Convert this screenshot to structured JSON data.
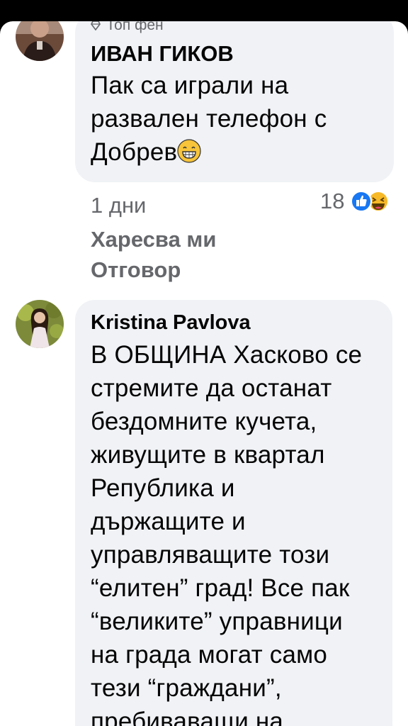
{
  "comments": [
    {
      "badge": "Топ фен",
      "author": "ИВАН ГИКОВ",
      "lines": [
        "Пак са играли на",
        "развален телефон с",
        "Добрев"
      ],
      "time": "1 дни",
      "like_label": "Харесва ми",
      "reply_label": "Отговор",
      "reaction_count": "18",
      "reactions": [
        "like-icon",
        "haha-icon"
      ]
    },
    {
      "author": "Kristina Pavlova",
      "lines": [
        "В ОБЩИНА Хасково се",
        "стремите да останат",
        "бездомните кучета,",
        "живущите в квартал",
        "Република и",
        "държащите и",
        "управляващите този",
        "“елитен” град! Все пак",
        "“великите” управници",
        "на града могат само",
        "тези “граждани”,",
        "пребиваващи на"
      ]
    }
  ],
  "colors": {
    "bubble": "#f0f2f5",
    "meta_text": "#65676b",
    "primary_text": "#050505",
    "like_blue": "#1877f2",
    "haha_yellow": "#f7b928"
  }
}
